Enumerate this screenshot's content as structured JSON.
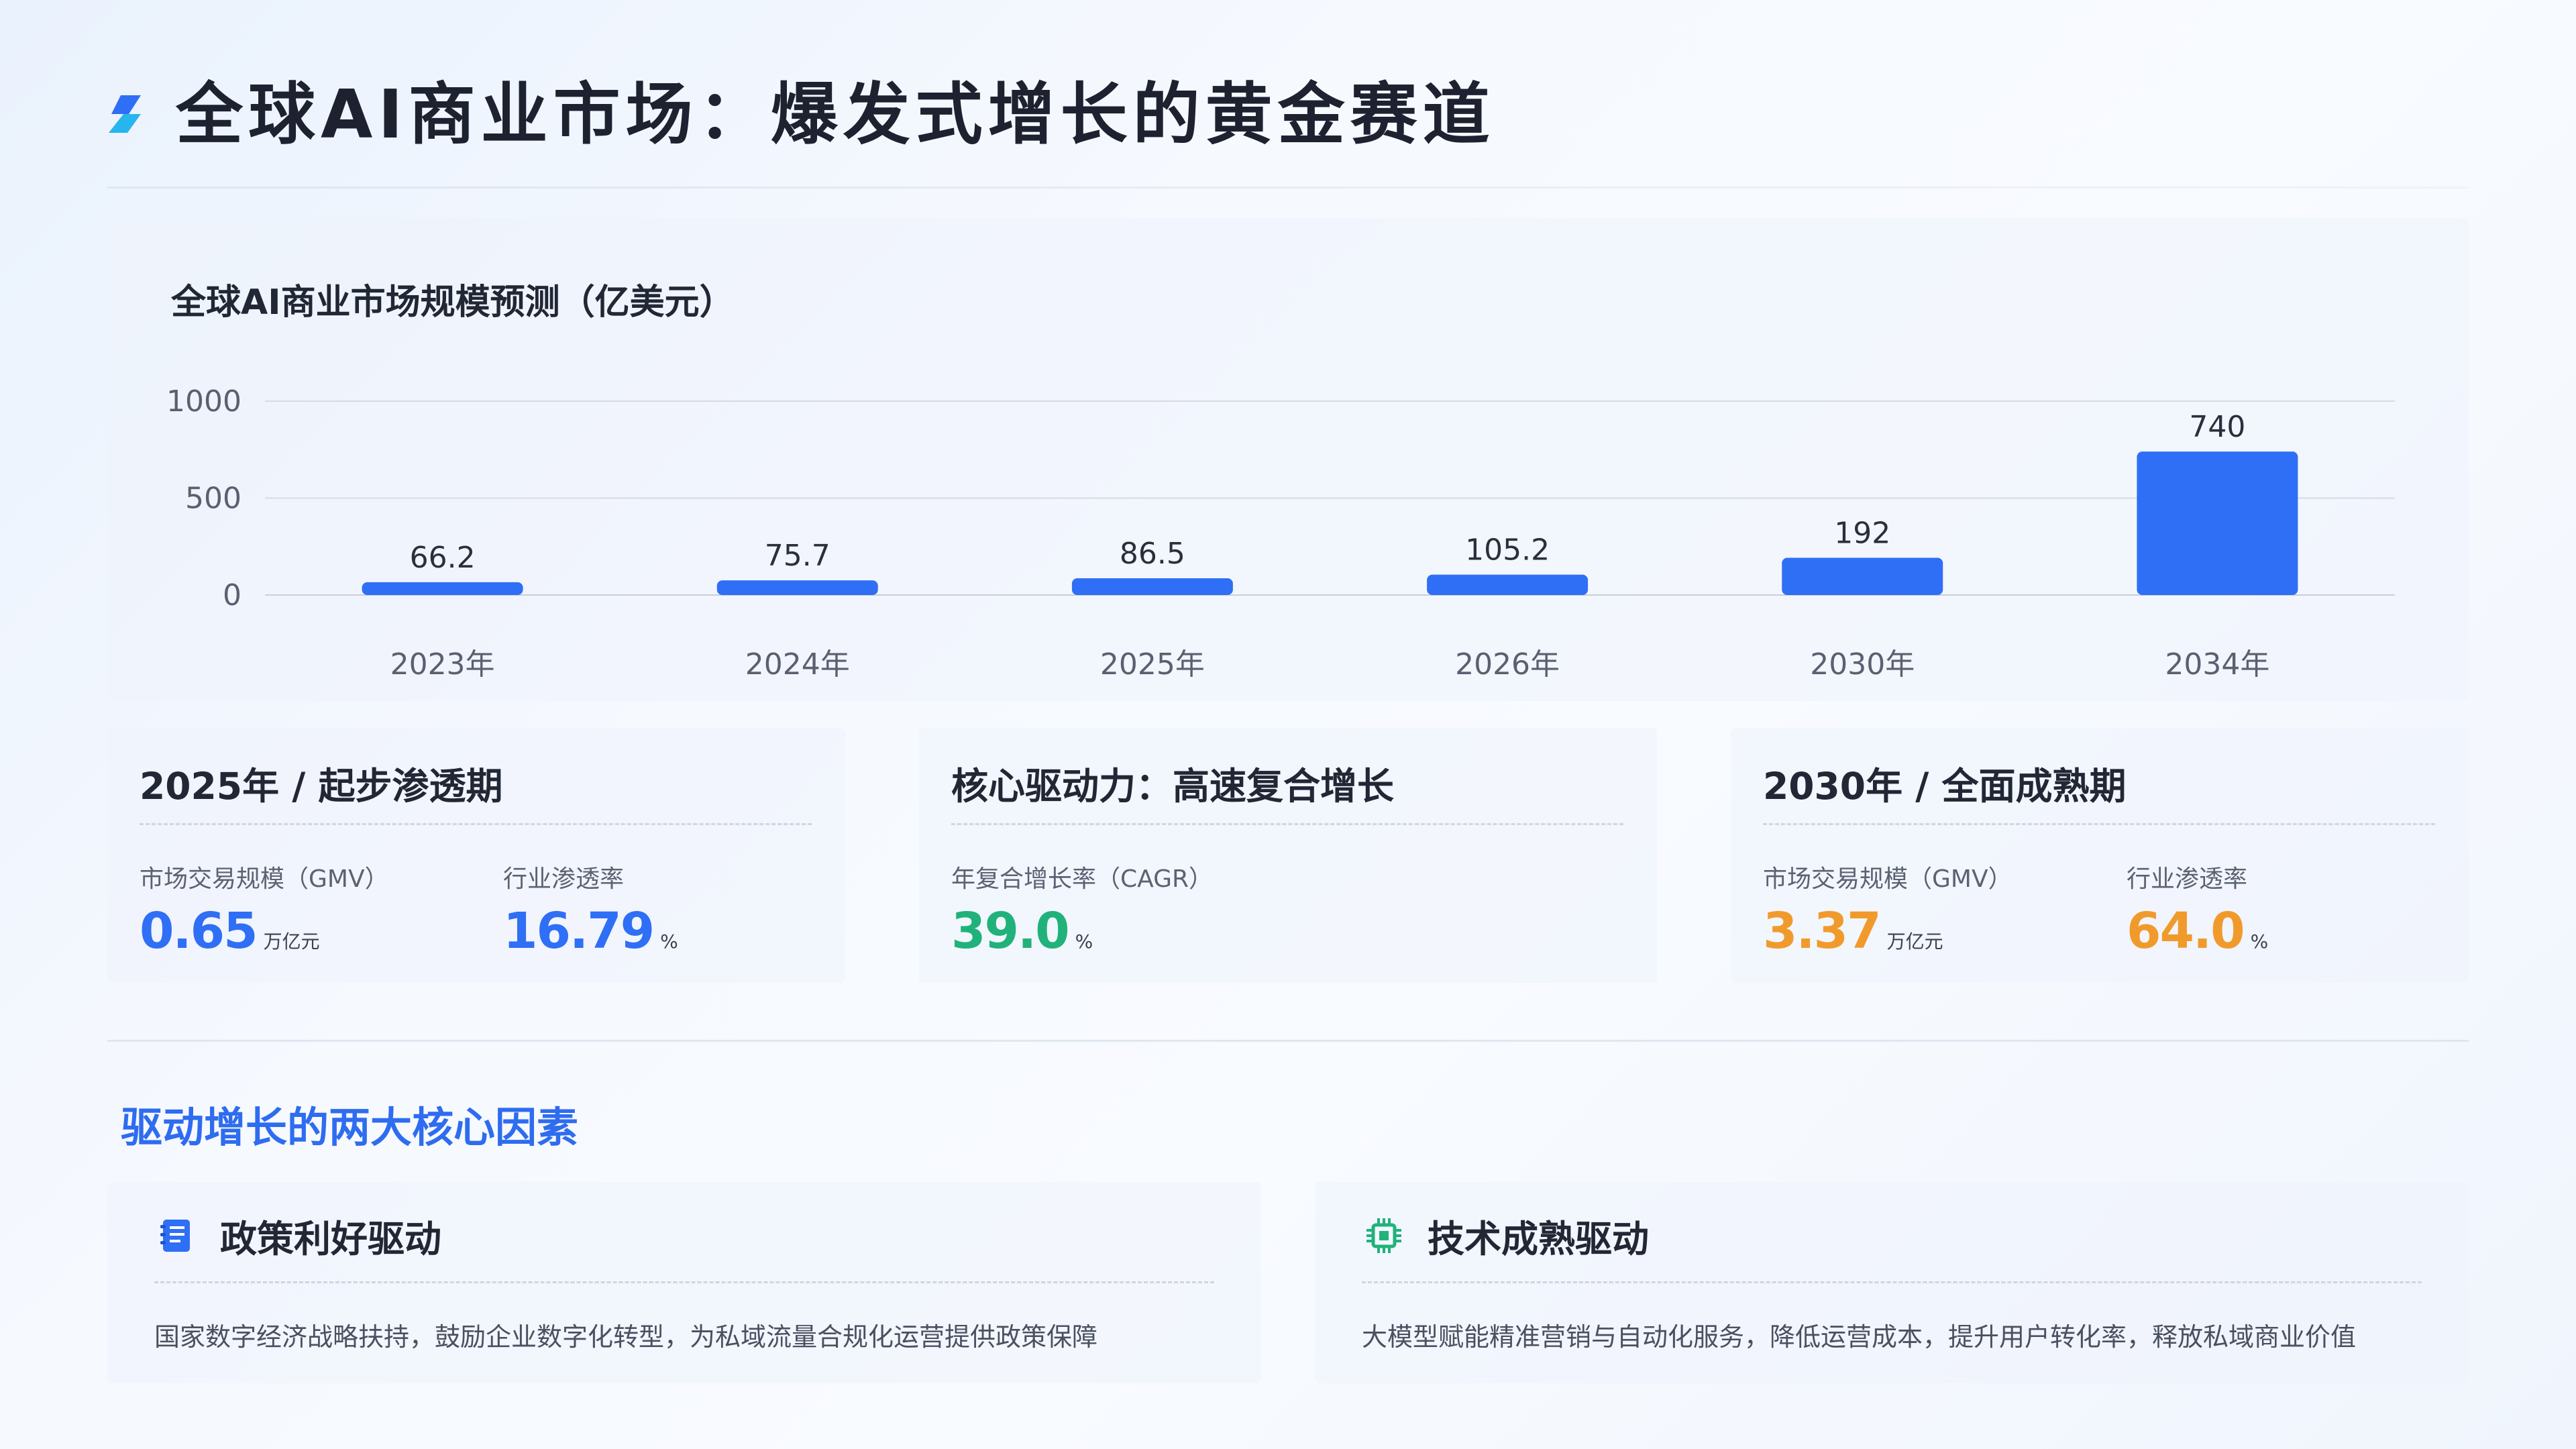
{
  "header": {
    "title": "全球AI商业市场：爆发式增长的黄金赛道"
  },
  "chart_data": {
    "type": "bar",
    "title": "全球AI商业市场规模预测（亿美元）",
    "categories": [
      "2023年",
      "2024年",
      "2025年",
      "2026年",
      "2030年",
      "2034年"
    ],
    "values": [
      66.2,
      75.7,
      86.5,
      105.2,
      192,
      740
    ],
    "value_labels": [
      "66.2",
      "75.7",
      "86.5",
      "105.2",
      "192",
      "740"
    ],
    "y_ticks": [
      0,
      500,
      1000
    ],
    "ylim": [
      0,
      1000
    ],
    "grid": true,
    "bar_color": "#2f6ff5"
  },
  "stats": [
    {
      "title": "2025年 / 起步渗透期",
      "color": "#2f6ff5",
      "metrics": [
        {
          "label": "市场交易规模（GMV）",
          "value": "0.65",
          "unit": "万亿元"
        },
        {
          "label": "行业渗透率",
          "value": "16.79",
          "unit": "%"
        }
      ]
    },
    {
      "title": "核心驱动力：高速复合增长",
      "color": "#20b27a",
      "metrics": [
        {
          "label": "年复合增长率（CAGR）",
          "value": "39.0",
          "unit": "%"
        }
      ]
    },
    {
      "title": "2030年 / 全面成熟期",
      "color": "#f19a2c",
      "metrics": [
        {
          "label": "市场交易规模（GMV）",
          "value": "3.37",
          "unit": "万亿元"
        },
        {
          "label": "行业渗透率",
          "value": "64.0",
          "unit": "%"
        }
      ]
    }
  ],
  "factors_section": {
    "title": "驱动增长的两大核心因素",
    "items": [
      {
        "icon": "policy-document-icon",
        "title": "政策利好驱动",
        "desc": "国家数字经济战略扶持，鼓励企业数字化转型，为私域流量合规化运营提供政策保障"
      },
      {
        "icon": "chip-icon",
        "title": "技术成熟驱动",
        "desc": "大模型赋能精准营销与自动化服务，降低运营成本，提升用户转化率，释放私域商业价值"
      }
    ]
  },
  "colors": {
    "accent": "#2f6ff5",
    "green": "#20b27a",
    "orange": "#f19a2c",
    "section_title": "#2e6cf0"
  }
}
